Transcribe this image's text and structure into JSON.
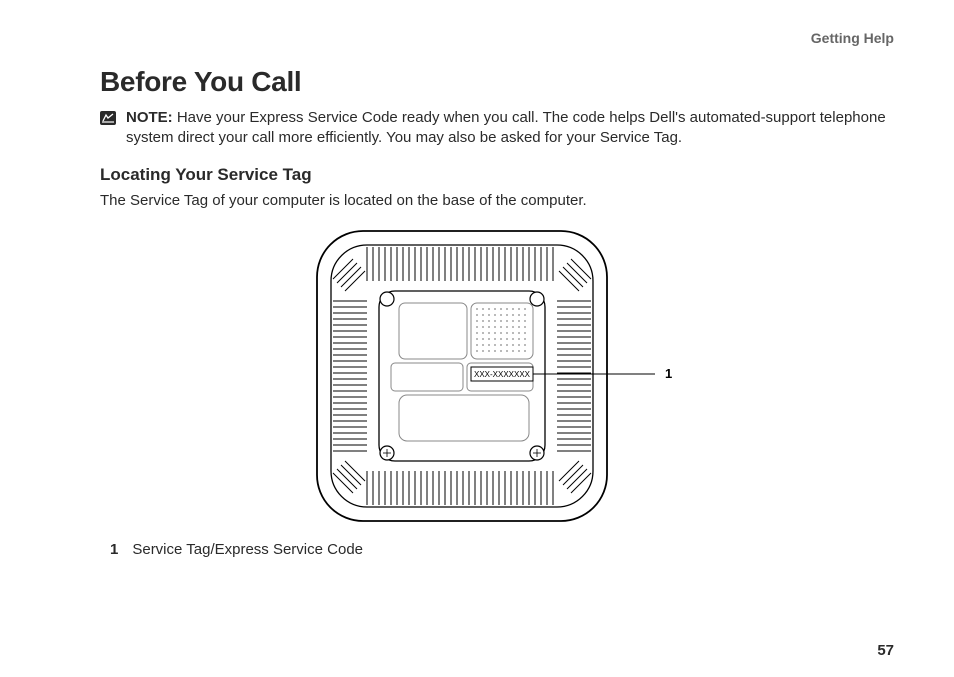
{
  "chapter": "Getting Help",
  "heading": "Before You Call",
  "note": {
    "label": "NOTE:",
    "text": " Have your Express Service Code ready when you call. The code helps Dell's automated-support telephone system direct your call more efficiently. You may also be asked for your Service Tag."
  },
  "subheading": "Locating Your Service Tag",
  "body": "The Service Tag of your computer is located on the base of the computer.",
  "figure": {
    "tag_placeholder": "XXX-XXXXXXX",
    "callout_number": "1"
  },
  "legend": {
    "num": "1",
    "text": "Service Tag/Express Service Code"
  },
  "page_number": "57"
}
